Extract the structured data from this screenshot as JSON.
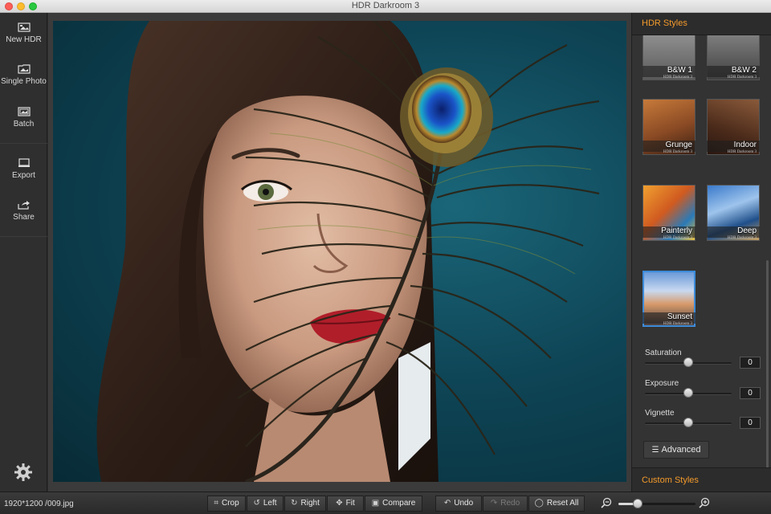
{
  "window": {
    "title": "HDR Darkroom 3"
  },
  "sidebar": {
    "items": [
      {
        "label": "New HDR",
        "icon": "new-hdr-icon"
      },
      {
        "label": "Single Photo",
        "icon": "single-photo-icon"
      },
      {
        "label": "Batch",
        "icon": "batch-icon"
      },
      {
        "label": "Export",
        "icon": "export-icon"
      },
      {
        "label": "Share",
        "icon": "share-icon"
      }
    ],
    "settings_icon": "gear-icon"
  },
  "right_panel": {
    "hdr_styles_title": "HDR Styles",
    "custom_styles_title": "Custom Styles",
    "styles": [
      {
        "name": "B&W 1",
        "sub": "HDR Darkroom 3"
      },
      {
        "name": "B&W 2",
        "sub": "HDR Darkroom 3"
      },
      {
        "name": "Grunge",
        "sub": "HDR Darkroom 3"
      },
      {
        "name": "Indoor",
        "sub": "HDR Darkroom 3"
      },
      {
        "name": "Painterly",
        "sub": "HDR Darkroom 3"
      },
      {
        "name": "Deep",
        "sub": "HDR Darkroom 3"
      },
      {
        "name": "Sunset",
        "sub": "HDR Darkroom 3",
        "selected": true
      }
    ],
    "sliders": [
      {
        "label": "Saturation",
        "value": "0",
        "level": 0.5
      },
      {
        "label": "Exposure",
        "value": "0",
        "level": 0.5
      },
      {
        "label": "Vignette",
        "value": "0",
        "level": 0.5
      }
    ],
    "advanced_label": "Advanced"
  },
  "bottom_bar": {
    "file_info": "1920*1200 /009.jpg",
    "buttons": [
      {
        "label": "Crop",
        "icon": "crop-icon",
        "enabled": true
      },
      {
        "label": "Left",
        "icon": "rotate-left-icon",
        "enabled": true
      },
      {
        "label": "Right",
        "icon": "rotate-right-icon",
        "enabled": true
      },
      {
        "label": "Fit",
        "icon": "fit-icon",
        "enabled": true
      },
      {
        "label": "Compare",
        "icon": "compare-icon",
        "enabled": true
      },
      {
        "label": "Undo",
        "icon": "undo-icon",
        "enabled": true
      },
      {
        "label": "Redo",
        "icon": "redo-icon",
        "enabled": false
      },
      {
        "label": "Reset All",
        "icon": "reset-icon",
        "enabled": true
      }
    ],
    "zoom_level": 0.25
  },
  "colors": {
    "accent": "#f39a2b",
    "selection": "#3d8bd9"
  }
}
